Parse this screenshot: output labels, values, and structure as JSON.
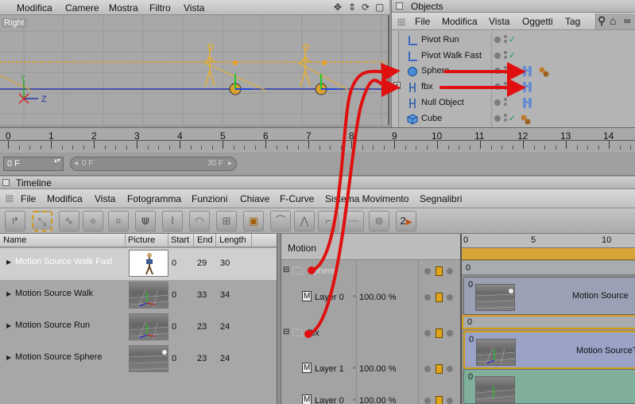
{
  "viewport_menu": [
    "Modifica",
    "Camere",
    "Mostra",
    "Filtro",
    "Vista"
  ],
  "viewport": {
    "label": "Right",
    "axis_z": "Z",
    "axis_y": "Y"
  },
  "objects": {
    "title": "Objects",
    "menu": [
      "File",
      "Modifica",
      "Vista",
      "Oggetti",
      "Tag"
    ],
    "rows": [
      {
        "name": "Pivot Run",
        "icon": "pivot-icon"
      },
      {
        "name": "Pivot Walk Fast",
        "icon": "pivot-icon"
      },
      {
        "name": "Sphere",
        "icon": "sphere-icon"
      },
      {
        "name": "fbx",
        "icon": "null-icon"
      },
      {
        "name": "Null Object",
        "icon": "null-icon"
      },
      {
        "name": "Cube",
        "icon": "cube-icon"
      }
    ]
  },
  "ruler": {
    "labels": [
      "0",
      "1",
      "2",
      "3",
      "4",
      "5",
      "6",
      "7",
      "8",
      "9",
      "10",
      "11",
      "12",
      "13",
      "14"
    ]
  },
  "range": {
    "current_frame": "0 F",
    "start": "0 F",
    "end": "30 F"
  },
  "timeline": {
    "title": "Timeline",
    "menu": [
      "File",
      "Modifica",
      "Vista",
      "Fotogramma",
      "Funzioni",
      "Chiave",
      "F-Curve",
      "Sistema Movimento",
      "Segnalibri"
    ],
    "toolbar_badge": "2"
  },
  "library": {
    "columns": [
      "Name",
      "Picture",
      "Start",
      "End",
      "Length"
    ],
    "rows": [
      {
        "name": "Motion Source Walk Fast",
        "start": "0",
        "end": "29",
        "length": "30"
      },
      {
        "name": "Motion Source Walk",
        "start": "0",
        "end": "33",
        "length": "34"
      },
      {
        "name": "Motion Source Run",
        "start": "0",
        "end": "23",
        "length": "24"
      },
      {
        "name": "Motion Source Sphere",
        "start": "0",
        "end": "23",
        "length": "24"
      }
    ]
  },
  "motion": {
    "header": "Motion",
    "rows": [
      {
        "label": "Sphere",
        "kind": "folder"
      },
      {
        "label": "Layer 0",
        "kind": "layer",
        "pct": "100.00 %"
      },
      {
        "label": "fbx",
        "kind": "folder"
      },
      {
        "label": "Layer 1",
        "kind": "layer",
        "pct": "100.00 %"
      },
      {
        "label": "Layer 0",
        "kind": "layer",
        "pct": "100.00 %"
      }
    ]
  },
  "tracks": {
    "ruler": [
      "0",
      "5",
      "10"
    ],
    "rows": [
      {
        "zero": "0"
      },
      {
        "zero": "0",
        "clip": "Motion Source"
      },
      {
        "zero": "0"
      },
      {
        "zero": "0",
        "clip": "Motion SourceT"
      },
      {
        "zero": "0"
      }
    ]
  },
  "colors": {
    "accent_orange": "#d49a1a",
    "arrow_red": "#e01010",
    "check_green": "#1aa04a"
  }
}
